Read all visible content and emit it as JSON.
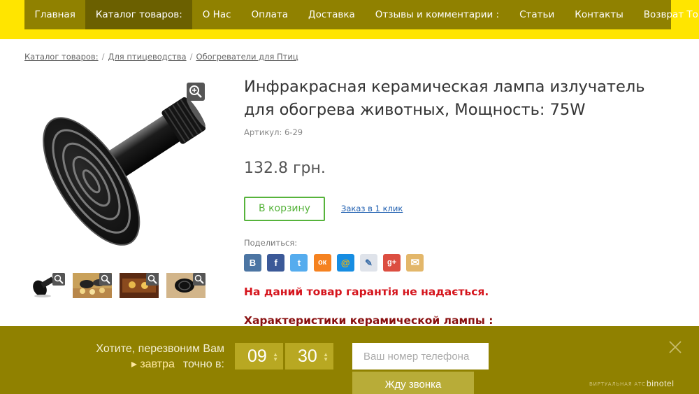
{
  "nav": {
    "items": [
      {
        "label": "Главная"
      },
      {
        "label": "Каталог товаров:"
      },
      {
        "label": "О Нас"
      },
      {
        "label": "Оплата"
      },
      {
        "label": "Доставка"
      },
      {
        "label": "Отзывы и комментарии :"
      },
      {
        "label": "Статьи"
      },
      {
        "label": "Контакты"
      },
      {
        "label": "Возврат Товара"
      }
    ],
    "active_index": 1
  },
  "breadcrumb": {
    "items": [
      "Каталог товаров:",
      "Для птицеводства",
      "Обогреватели для Птиц"
    ],
    "separator": "/"
  },
  "product": {
    "title": "Инфракрасная керамическая лампа излучатель для обогрева животных, Мощность: 75W",
    "sku": "Артикул: 6-29",
    "price": "132.8 грн.",
    "cart_label": "В корзину",
    "one_click_label": "Заказ в 1 клик",
    "share_label": "Поделиться:",
    "warranty_note": "На даний товар гарантія не надається.",
    "characteristics_heading": "Характеристики керамической лампы :"
  },
  "share": {
    "buttons": [
      {
        "name": "vk",
        "glyph": "В",
        "color": "#4c75a3"
      },
      {
        "name": "facebook",
        "glyph": "f",
        "color": "#3b5998"
      },
      {
        "name": "twitter",
        "glyph": "t",
        "color": "#55acee"
      },
      {
        "name": "odnoklassniki",
        "glyph": "ок",
        "color": "#f58220"
      },
      {
        "name": "mailru",
        "glyph": "@",
        "color": "#168de2"
      },
      {
        "name": "livejournal",
        "glyph": "✎",
        "color": "#dfe3ea"
      },
      {
        "name": "googleplus",
        "glyph": "g+",
        "color": "#dc4e41"
      },
      {
        "name": "email",
        "glyph": "✉",
        "color": "#e3b76a"
      }
    ]
  },
  "callback": {
    "line1": "Хотите, перезвоним Вам",
    "day": "завтра",
    "line2_suffix": "точно в:",
    "hour": "09",
    "minute": "30",
    "phone_placeholder": "Ваш номер телефона",
    "submit_label": "Жду звонка",
    "vendor_caption": "ВИРТУАЛЬНАЯ АТС",
    "vendor": "binotel"
  },
  "colors": {
    "yellow_band": "#ffe500",
    "nav_bg": "#908100",
    "nav_active": "#6b6000",
    "cart_green": "#56b33b",
    "warning_red": "#d5141c",
    "link_blue": "#1f5fb0"
  }
}
